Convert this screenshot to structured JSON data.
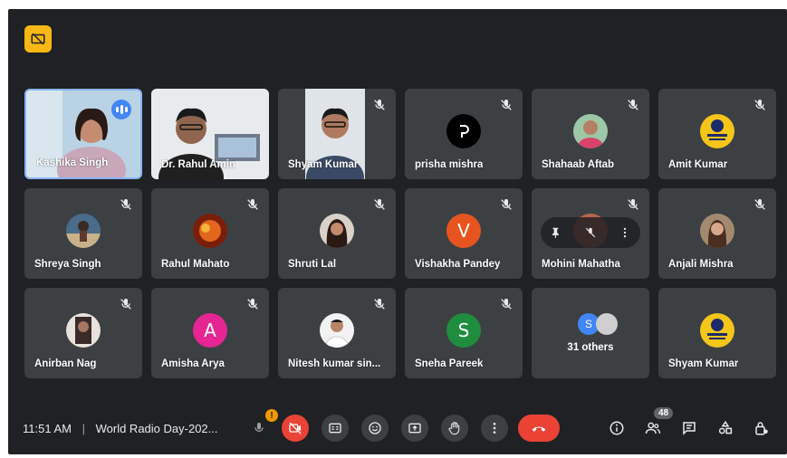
{
  "tiles": [
    {
      "name": "Kashika Singh",
      "type": "video",
      "speaking": true
    },
    {
      "name": "Dr. Rahul Amin",
      "type": "video"
    },
    {
      "name": "Shyam Kumar",
      "type": "video",
      "muted": true
    },
    {
      "name": "prisha mishra",
      "type": "avatar",
      "muted": true
    },
    {
      "name": "Shahaab Aftab",
      "type": "avatar",
      "muted": true
    },
    {
      "name": "Amit Kumar",
      "type": "avatar",
      "muted": true
    },
    {
      "name": "Shreya Singh",
      "type": "avatar",
      "muted": true
    },
    {
      "name": "Rahul Mahato",
      "type": "avatar",
      "muted": true
    },
    {
      "name": "Shruti Lal",
      "type": "avatar",
      "muted": true
    },
    {
      "name": "Vishakha Pandey",
      "type": "letter",
      "letter": "V",
      "color": "#e8541f",
      "muted": true
    },
    {
      "name": "Mohini Mahatha",
      "type": "hover",
      "muted": true
    },
    {
      "name": "Anjali Mishra",
      "type": "avatar",
      "muted": true
    },
    {
      "name": "Anirban Nag",
      "type": "avatar",
      "muted": true
    },
    {
      "name": "Amisha Arya",
      "type": "letter",
      "letter": "A",
      "color": "#e52592",
      "muted": true
    },
    {
      "name": "Nitesh kumar sin...",
      "type": "avatar",
      "muted": true
    },
    {
      "name": "Sneha Pareek",
      "type": "letter",
      "letter": "S",
      "color": "#1e8e3e",
      "muted": true
    },
    {
      "name": "31 others",
      "type": "others",
      "letter": "S"
    },
    {
      "name": "Shyam Kumar",
      "type": "avatar",
      "muted": false
    }
  ],
  "bottombar": {
    "time": "11:51 AM",
    "separator": "|",
    "meeting_title": "World Radio Day-202...",
    "mic_alert": "!",
    "participant_count": "48"
  },
  "colors": {
    "background": "#202124",
    "tile": "#3c4043",
    "end_call": "#ea4335",
    "speaking": "#4285f4"
  }
}
